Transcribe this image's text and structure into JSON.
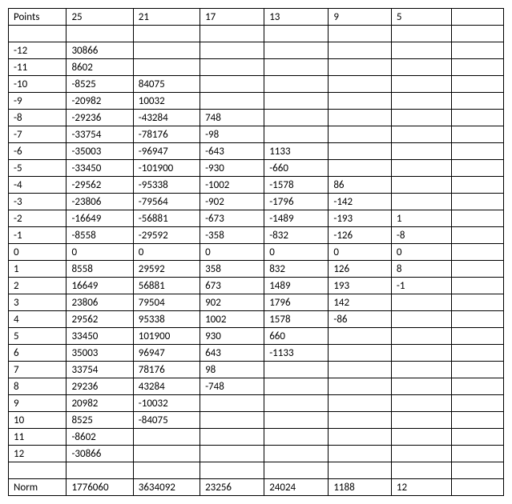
{
  "chart_data": {
    "type": "table",
    "title": "",
    "columns": [
      "Points",
      "25",
      "21",
      "17",
      "13",
      "9",
      "5",
      ""
    ],
    "rows": [
      [
        "",
        "",
        "",
        "",
        "",
        "",
        "",
        ""
      ],
      [
        "-12",
        "30866",
        "",
        "",
        "",
        "",
        "",
        ""
      ],
      [
        "-11",
        "8602",
        "",
        "",
        "",
        "",
        "",
        ""
      ],
      [
        "-10",
        "-8525",
        "84075",
        "",
        "",
        "",
        "",
        ""
      ],
      [
        "-9",
        "-20982",
        "10032",
        "",
        "",
        "",
        "",
        ""
      ],
      [
        "-8",
        "-29236",
        "-43284",
        "748",
        "",
        "",
        "",
        ""
      ],
      [
        "-7",
        "-33754",
        "-78176",
        "-98",
        "",
        "",
        "",
        ""
      ],
      [
        "-6",
        "-35003",
        "-96947",
        "-643",
        "1133",
        "",
        "",
        ""
      ],
      [
        "-5",
        "-33450",
        "-101900",
        "-930",
        "-660",
        "",
        "",
        ""
      ],
      [
        "-4",
        "-29562",
        "-95338",
        "-1002",
        "-1578",
        "86",
        "",
        ""
      ],
      [
        "-3",
        "-23806",
        "-79564",
        "-902",
        "-1796",
        "-142",
        "",
        ""
      ],
      [
        "-2",
        "-16649",
        "-56881",
        "-673",
        "-1489",
        "-193",
        "1",
        ""
      ],
      [
        "-1",
        "-8558",
        "-29592",
        "-358",
        "-832",
        "-126",
        "-8",
        ""
      ],
      [
        "0",
        "0",
        "0",
        "0",
        "0",
        "0",
        "0",
        ""
      ],
      [
        "1",
        "8558",
        "29592",
        "358",
        "832",
        "126",
        "8",
        ""
      ],
      [
        "2",
        "16649",
        "56881",
        "673",
        "1489",
        "193",
        "-1",
        ""
      ],
      [
        "3",
        "23806",
        "79504",
        "902",
        "1796",
        "142",
        "",
        ""
      ],
      [
        "4",
        "29562",
        "95338",
        "1002",
        "1578",
        "-86",
        "",
        ""
      ],
      [
        "5",
        "33450",
        "101900",
        "930",
        "660",
        "",
        "",
        ""
      ],
      [
        "6",
        "35003",
        "96947",
        "643",
        "-1133",
        "",
        "",
        ""
      ],
      [
        "7",
        "33754",
        "78176",
        "98",
        "",
        "",
        "",
        ""
      ],
      [
        "8",
        "29236",
        "43284",
        "-748",
        "",
        "",
        "",
        ""
      ],
      [
        "9",
        "20982",
        "-10032",
        "",
        "",
        "",
        "",
        ""
      ],
      [
        "10",
        "8525",
        "-84075",
        "",
        "",
        "",
        "",
        ""
      ],
      [
        "11",
        "-8602",
        "",
        "",
        "",
        "",
        "",
        ""
      ],
      [
        "12",
        "-30866",
        "",
        "",
        "",
        "",
        "",
        ""
      ],
      [
        "",
        "",
        "",
        "",
        "",
        "",
        "",
        ""
      ],
      [
        "Norm",
        "1776060",
        "3634092",
        "23256",
        "24024",
        "1188",
        "12",
        ""
      ]
    ]
  }
}
